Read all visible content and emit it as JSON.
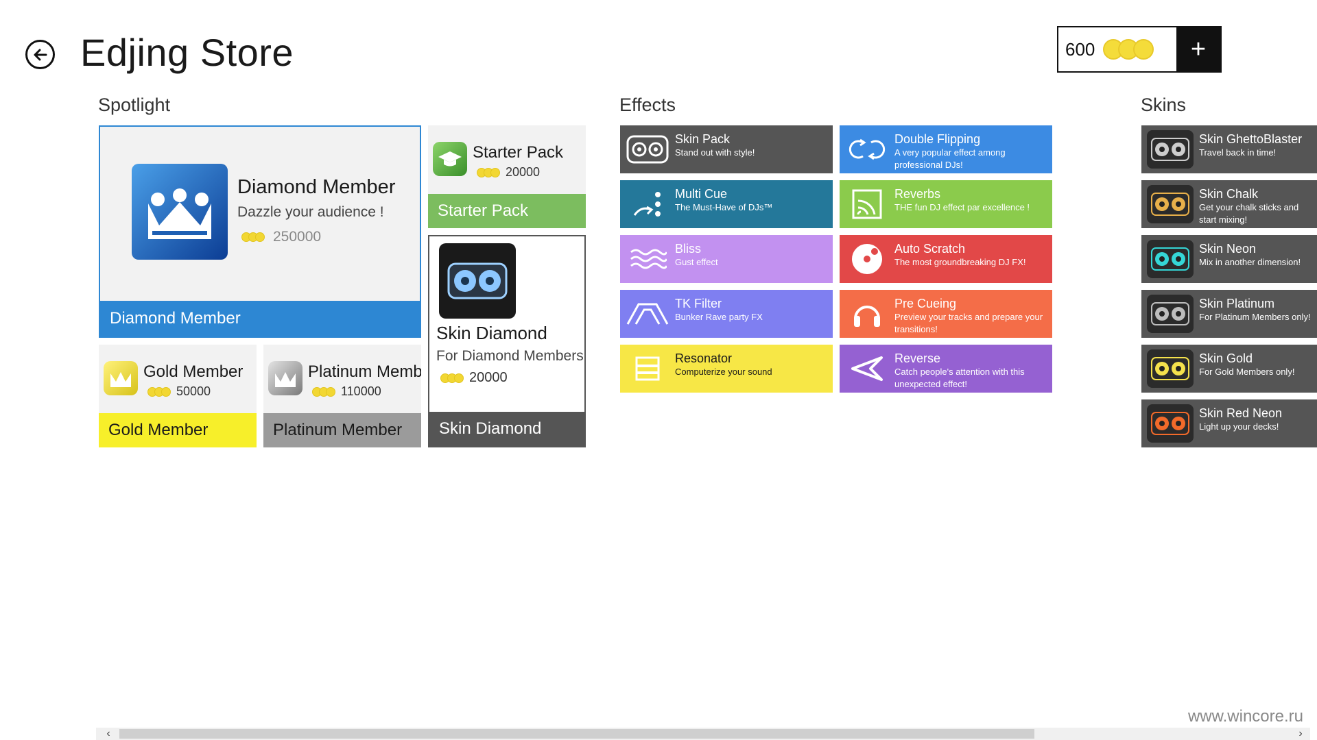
{
  "header": {
    "title": "Edjing Store",
    "balance": "600",
    "add_label": "+"
  },
  "sections": {
    "spotlight": "Spotlight",
    "effects": "Effects",
    "skins": "Skins"
  },
  "spotlight": {
    "diamond": {
      "name": "Diamond Member",
      "desc": "Dazzle your audience !",
      "price": "250000",
      "footer": "Diamond Member",
      "color": "#2d87d3"
    },
    "starter": {
      "name": "Starter Pack",
      "price": "20000",
      "footer": "Starter Pack",
      "color": "#7cbd5f"
    },
    "skin_diamond": {
      "name": "Skin Diamond",
      "desc": "For Diamond Members only!",
      "price": "20000",
      "footer": "Skin Diamond",
      "color": "#555555"
    },
    "gold": {
      "name": "Gold Member",
      "price": "50000",
      "footer": "Gold Member",
      "color": "#f7ef2a"
    },
    "platinum": {
      "name": "Platinum Member",
      "price": "110000",
      "footer": "Platinum Member",
      "color": "#9b9b9b"
    }
  },
  "effects": [
    {
      "name": "Skin Pack",
      "desc": "Stand out with style!",
      "icon": "tape-icon",
      "color": "#555555"
    },
    {
      "name": "Double Flipping",
      "desc": "A very popular effect among professional DJs!",
      "icon": "double-flip-icon",
      "color": "#3c8be3"
    },
    {
      "name": "Multi Cue",
      "desc": "The Must-Have of DJs™",
      "icon": "multi-cue-icon",
      "color": "#24789a"
    },
    {
      "name": "Reverbs",
      "desc": "THE fun DJ effect par excellence !",
      "icon": "reverb-icon",
      "color": "#8bcb4c"
    },
    {
      "name": "Bliss",
      "desc": "Gust effect",
      "icon": "wave-icon",
      "color": "#c291f0"
    },
    {
      "name": "Auto Scratch",
      "desc": "The most groundbreaking DJ FX!",
      "icon": "record-icon",
      "color": "#e24848"
    },
    {
      "name": "TK Filter",
      "desc": "Bunker Rave party FX",
      "icon": "filter-icon",
      "color": "#7f7ff1"
    },
    {
      "name": "Pre Cueing",
      "desc": "Preview your tracks and prepare your transitions!",
      "icon": "headphones-icon",
      "color": "#f46d48"
    },
    {
      "name": "Resonator",
      "desc": "Computerize your sound",
      "icon": "resonator-icon",
      "color": "#f7e746"
    },
    {
      "name": "Reverse",
      "desc": "Catch people's attention with this unexpected effect!",
      "icon": "reverse-icon",
      "color": "#9561d2"
    }
  ],
  "skins": [
    {
      "name": "Skin GhettoBlaster",
      "desc": "Travel back in time!",
      "accent": "#cccccc"
    },
    {
      "name": "Skin Chalk",
      "desc": "Get your chalk sticks and start mixing!",
      "accent": "#e8b04a"
    },
    {
      "name": "Skin Neon",
      "desc": "Mix in another dimension!",
      "accent": "#35d6d6"
    },
    {
      "name": "Skin Platinum",
      "desc": "For Platinum Members only!",
      "accent": "#bdbdbd"
    },
    {
      "name": "Skin Gold",
      "desc": "For Gold Members only!",
      "accent": "#f4e14c"
    },
    {
      "name": "Skin Red Neon",
      "desc": "Light up your decks!",
      "accent": "#f26a2a"
    }
  ],
  "watermark": "www.wincore.ru"
}
